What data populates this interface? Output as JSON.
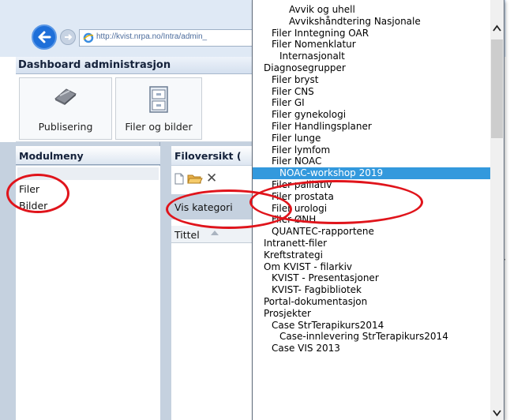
{
  "browser": {
    "url": "http://kvist.nrpa.no/Intra/admin_"
  },
  "dashboard": {
    "title": "Dashboard administrasjon",
    "toolbar": [
      {
        "label": "Publisering",
        "icon": "eraser-icon"
      },
      {
        "label": "Filer og bilder",
        "icon": "file-cabinet-icon"
      }
    ]
  },
  "module_menu": {
    "title": "Modulmeny",
    "items": [
      "Filer",
      "Bilder"
    ]
  },
  "file_overview": {
    "title": "Filoversikt (",
    "category_label": "Vis kategori",
    "column_title": "Tittel",
    "toolbar_icons": [
      "new-file-icon",
      "open-folder-icon",
      "delete-icon"
    ]
  },
  "dropdown": {
    "items": [
      {
        "label": "Avvik og uhell",
        "indent": 3
      },
      {
        "label": "Avvikshåndtering Nasjonale",
        "indent": 3
      },
      {
        "label": "Filer Inntegning OAR",
        "indent": 1
      },
      {
        "label": "Filer Nomenklatur",
        "indent": 1
      },
      {
        "label": "Internasjonalt",
        "indent": 2
      },
      {
        "label": "Diagnosegrupper",
        "indent": 0
      },
      {
        "label": "Filer bryst",
        "indent": 1
      },
      {
        "label": "Filer CNS",
        "indent": 1
      },
      {
        "label": "Filer GI",
        "indent": 1
      },
      {
        "label": "Filer gynekologi",
        "indent": 1
      },
      {
        "label": "Filer Handlingsplaner",
        "indent": 1
      },
      {
        "label": "Filer lunge",
        "indent": 1
      },
      {
        "label": "Filer lymfom",
        "indent": 1
      },
      {
        "label": "Filer NOAC",
        "indent": 1
      },
      {
        "label": "NOAC-workshop 2019",
        "indent": 2,
        "selected": true
      },
      {
        "label": "Filer palliativ",
        "indent": 1
      },
      {
        "label": "Filer prostata",
        "indent": 1
      },
      {
        "label": "Filer urologi",
        "indent": 1
      },
      {
        "label": "Filer ØNH",
        "indent": 1
      },
      {
        "label": "QUANTEC-rapportene",
        "indent": 1
      },
      {
        "label": "Intranett-filer",
        "indent": 0
      },
      {
        "label": "Kreftstrategi",
        "indent": 0
      },
      {
        "label": "Om KVIST - filarkiv",
        "indent": 0
      },
      {
        "label": "KVIST - Presentasjoner",
        "indent": 1
      },
      {
        "label": "KVIST- Fagbibliotek",
        "indent": 1
      },
      {
        "label": "Portal-dokumentasjon",
        "indent": 0
      },
      {
        "label": "Prosjekter",
        "indent": 0
      },
      {
        "label": "Case StrTerapikurs2014",
        "indent": 1
      },
      {
        "label": "Case-innlevering StrTerapikurs2014",
        "indent": 2
      },
      {
        "label": "Case VIS 2013",
        "indent": 1
      }
    ]
  },
  "annotations": {
    "color": "#e0141b"
  },
  "colors": {
    "selection": "#3399dd",
    "panel": "#c5d1df"
  }
}
